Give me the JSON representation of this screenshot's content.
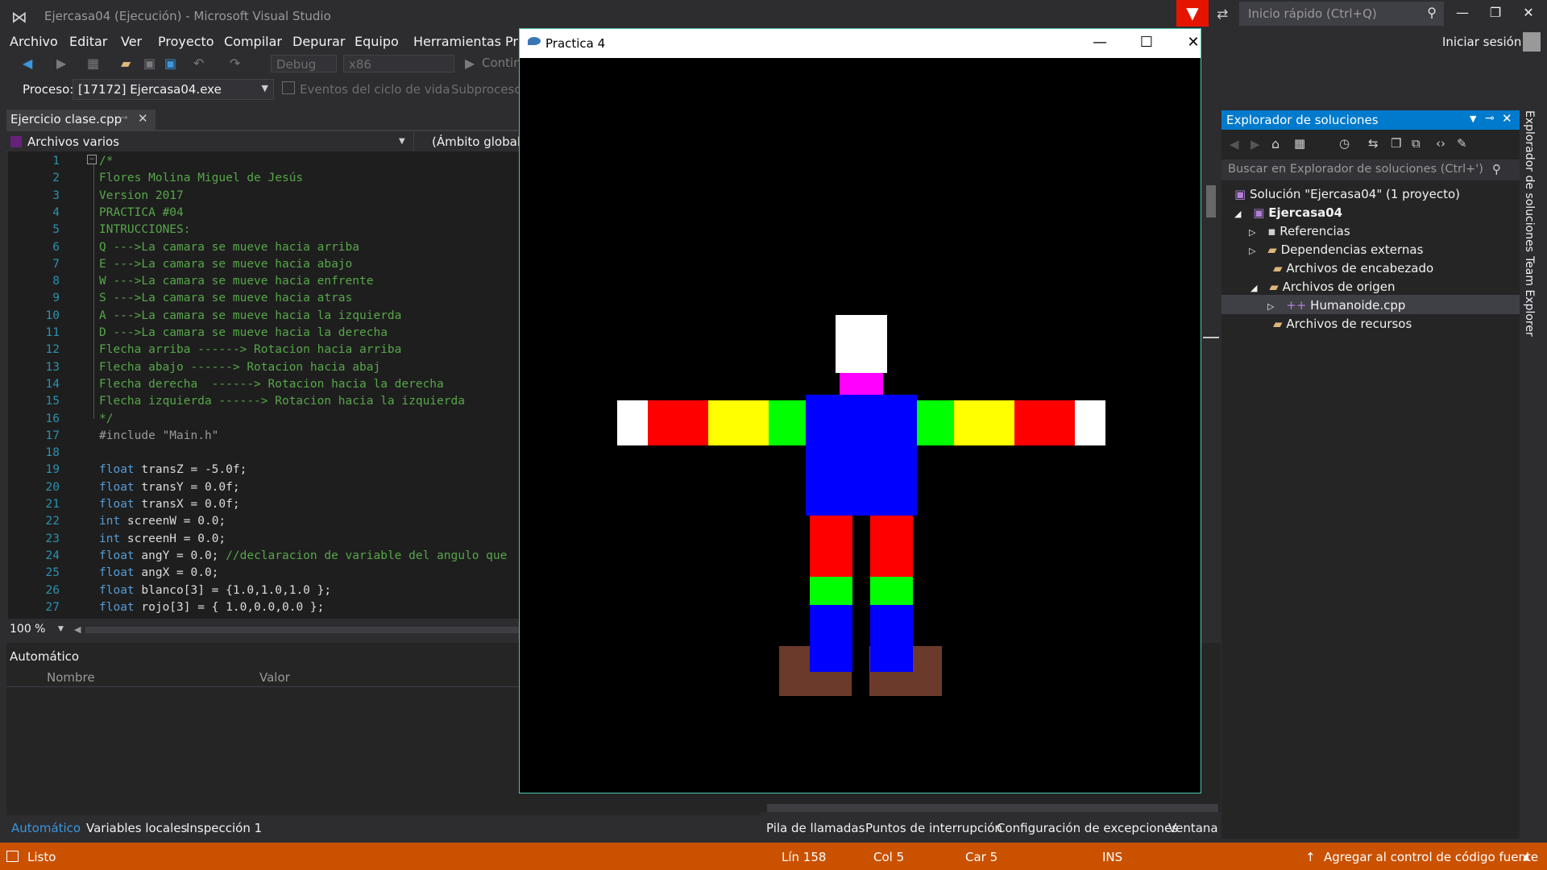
{
  "titlebar": {
    "title": "Ejercasa04 (Ejecución) - Microsoft Visual Studio",
    "quick_launch_placeholder": "Inicio rápido (Ctrl+Q)",
    "signin": "Iniciar sesión"
  },
  "menu": [
    "Archivo",
    "Editar",
    "Ver",
    "Proyecto",
    "Compilar",
    "Depurar",
    "Equipo",
    "Herramientas",
    "Pru"
  ],
  "toolbar": {
    "config": "Debug",
    "platform": "x86",
    "continue": "Contin"
  },
  "process": {
    "label": "Proceso:",
    "value": "[17172] Ejercasa04.exe",
    "lifecycle": "Eventos del ciclo de vida",
    "thread": "Subproceso:"
  },
  "editor": {
    "tab": "Ejercicio clase.cpp",
    "file_scope": "Archivos varios",
    "global_scope": "(Ámbito global)",
    "zoom": "100 %",
    "lines": [
      {
        "n": "1",
        "kind": "comment",
        "text": "/*"
      },
      {
        "n": "2",
        "kind": "comment",
        "text": "Flores Molina Miguel de Jesús"
      },
      {
        "n": "3",
        "kind": "comment",
        "text": "Version 2017"
      },
      {
        "n": "4",
        "kind": "comment",
        "text": "PRACTICA #04"
      },
      {
        "n": "5",
        "kind": "comment",
        "text": "INTRUCCIONES:"
      },
      {
        "n": "6",
        "kind": "comment",
        "text": "Q --->La camara se mueve hacia arriba"
      },
      {
        "n": "7",
        "kind": "comment",
        "text": "E --->La camara se mueve hacia abajo"
      },
      {
        "n": "8",
        "kind": "comment",
        "text": "W --->La camara se mueve hacia enfrente"
      },
      {
        "n": "9",
        "kind": "comment",
        "text": "S --->La camara se mueve hacia atras"
      },
      {
        "n": "10",
        "kind": "comment",
        "text": "A --->La camara se mueve hacia la izquierda"
      },
      {
        "n": "11",
        "kind": "comment",
        "text": "D --->La camara se mueve hacia la derecha"
      },
      {
        "n": "12",
        "kind": "comment",
        "text": "Flecha arriba ------> Rotacion hacia arriba"
      },
      {
        "n": "13",
        "kind": "comment",
        "text": "Flecha abajo ------> Rotacion hacia abaj"
      },
      {
        "n": "14",
        "kind": "comment",
        "text": "Flecha derecha  ------> Rotacion hacia la derecha"
      },
      {
        "n": "15",
        "kind": "comment",
        "text": "Flecha izquierda ------> Rotacion hacia la izquierda"
      },
      {
        "n": "16",
        "kind": "comment",
        "text": "*/"
      },
      {
        "n": "17",
        "kind": "include",
        "text": "#include \"Main.h\""
      },
      {
        "n": "18",
        "kind": "default",
        "text": ""
      },
      {
        "n": "19",
        "kind": "decl",
        "kw": "float",
        "text": " transZ = -5.0f;"
      },
      {
        "n": "20",
        "kind": "decl",
        "kw": "float",
        "text": " transY = 0.0f;"
      },
      {
        "n": "21",
        "kind": "decl",
        "kw": "float",
        "text": " transX = 0.0f;"
      },
      {
        "n": "22",
        "kind": "decl",
        "kw": "int",
        "text": " screenW = 0.0;"
      },
      {
        "n": "23",
        "kind": "decl",
        "kw": "int",
        "text": " screenH = 0.0;"
      },
      {
        "n": "24",
        "kind": "decl-comment",
        "kw": "float",
        "text": " angY = 0.0; ",
        "comment": "//declaracion de variable del angulo que"
      },
      {
        "n": "25",
        "kind": "decl",
        "kw": "float",
        "text": " angX = 0.0;"
      },
      {
        "n": "26",
        "kind": "decl",
        "kw": "float",
        "text": " blanco[3] = {1.0,1.0,1.0 };"
      },
      {
        "n": "27",
        "kind": "decl",
        "kw": "float",
        "text": " rojo[3] = { 1.0,0.0,0.0 };"
      }
    ]
  },
  "autos": {
    "title": "Automático",
    "col_name": "Nombre",
    "col_value": "Valor",
    "tabs": [
      "Automático",
      "Variables locales",
      "Inspección 1"
    ]
  },
  "debug_tabs": [
    "Pila de llamadas",
    "Puntos de interrupción",
    "Configuración de excepciones",
    "Ventana C"
  ],
  "solution_explorer": {
    "title": "Explorador de soluciones",
    "search_placeholder": "Buscar en Explorador de soluciones (Ctrl+')",
    "items": [
      {
        "label": "Solución \"Ejercasa04\"  (1 proyecto)",
        "icon": "solution-icon"
      },
      {
        "label": "Ejercasa04",
        "icon": "project-icon"
      },
      {
        "label": "Referencias",
        "icon": "references-icon"
      },
      {
        "label": "Dependencias externas",
        "icon": "folder-icon"
      },
      {
        "label": "Archivos de encabezado",
        "icon": "folder-icon"
      },
      {
        "label": "Archivos de origen",
        "icon": "folder-icon"
      },
      {
        "label": "Humanoide.cpp",
        "icon": "cpp-file-icon"
      },
      {
        "label": "Archivos de recursos",
        "icon": "folder-icon"
      }
    ],
    "side_tabs": [
      "Explorador de soluciones",
      "Team Explorer"
    ]
  },
  "statusbar": {
    "ready": "Listo",
    "line": "Lín 158",
    "col": "Col 5",
    "char": "Car 5",
    "mode": "INS",
    "source_control": "Agregar al control de código fuente"
  },
  "app_window": {
    "title": "Practica 4"
  },
  "colors": {
    "accent": "#007acc",
    "statusbar": "#ca5100",
    "red": "#ff0000",
    "yellow": "#ffff00",
    "green": "#00ff00",
    "blue": "#0000ff",
    "magenta": "#ff00ff",
    "brown": "#6b3a2a"
  }
}
